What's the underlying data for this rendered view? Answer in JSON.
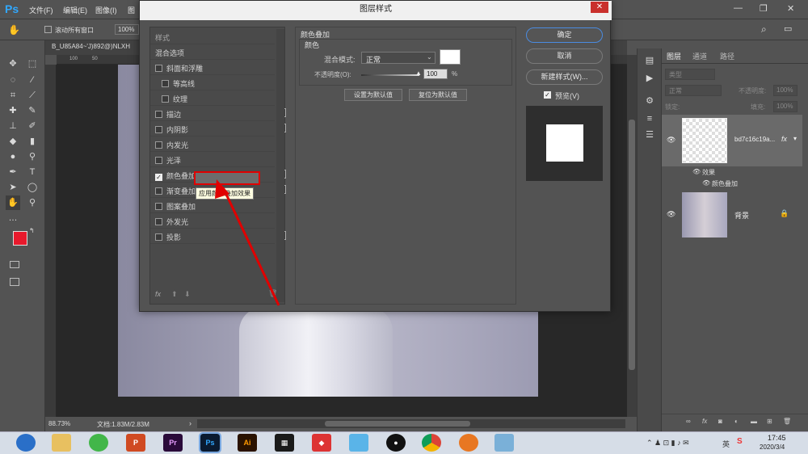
{
  "app": {
    "logo": "Ps"
  },
  "menubar": {
    "items": [
      "文件(F)",
      "编辑(E)",
      "图像(I)",
      "图"
    ]
  },
  "optionsbar": {
    "scroll_all": "滚动所有窗口",
    "zoom": "100%"
  },
  "document": {
    "tab": "B_U85A84~'J)892@)NLXH",
    "zoom_status": "88.73%",
    "doc_info": "文档:1.83M/2.83M",
    "ruler_labels": [
      "100",
      "50"
    ]
  },
  "dialog": {
    "title": "图层样式",
    "close": "✕",
    "list_header": "样式",
    "items": [
      {
        "label": "混合选项",
        "checkbox": false,
        "plus": false,
        "indent": false
      },
      {
        "label": "斜面和浮雕",
        "checkbox": true,
        "checked": false,
        "plus": false,
        "indent": false
      },
      {
        "label": "等高线",
        "checkbox": true,
        "checked": false,
        "plus": false,
        "indent": true
      },
      {
        "label": "纹理",
        "checkbox": true,
        "checked": false,
        "plus": false,
        "indent": true
      },
      {
        "label": "描边",
        "checkbox": true,
        "checked": false,
        "plus": true,
        "indent": false
      },
      {
        "label": "内阴影",
        "checkbox": true,
        "checked": false,
        "plus": true,
        "indent": false
      },
      {
        "label": "内发光",
        "checkbox": true,
        "checked": false,
        "plus": false,
        "indent": false
      },
      {
        "label": "光泽",
        "checkbox": true,
        "checked": false,
        "plus": false,
        "indent": false
      },
      {
        "label": "颜色叠加",
        "checkbox": true,
        "checked": true,
        "plus": true,
        "indent": false
      },
      {
        "label": "渐变叠加",
        "checkbox": true,
        "checked": false,
        "plus": true,
        "indent": false
      },
      {
        "label": "图案叠加",
        "checkbox": true,
        "checked": false,
        "plus": false,
        "indent": false
      },
      {
        "label": "外发光",
        "checkbox": true,
        "checked": false,
        "plus": false,
        "indent": false
      },
      {
        "label": "投影",
        "checkbox": true,
        "checked": false,
        "plus": true,
        "indent": false
      }
    ],
    "tooltip": "应用颜色叠加效果",
    "fx": "fx",
    "settings": {
      "group_title": "颜色叠加",
      "sub_title": "颜色",
      "blend_label": "混合模式:",
      "blend_value": "正常",
      "opacity_label": "不透明度(O):",
      "opacity_value": "100",
      "opacity_unit": "%",
      "set_default": "设置为默认值",
      "reset_default": "复位为默认值"
    },
    "buttons": {
      "ok": "确定",
      "cancel": "取消",
      "new_style": "新建样式(W)...",
      "preview": "预览(V)"
    }
  },
  "layers_panel": {
    "tabs": [
      "图层",
      "通道",
      "路径"
    ],
    "kind_placeholder": "类型",
    "blend": "正常",
    "opacity_label": "不透明度:",
    "opacity_value": "100%",
    "lock_label": "锁定:",
    "fill_label": "填充:",
    "fill_value": "100%",
    "layers": [
      {
        "name": "bd7c16c19a...",
        "fx": "fx",
        "effects_label": "效果",
        "effect": "颜色叠加"
      },
      {
        "name": "背景"
      }
    ]
  },
  "taskbar": {
    "apps": [
      "Pr",
      "Ps",
      "Ai"
    ],
    "time": "17:45",
    "date": "2020/3/4",
    "ime": "英"
  },
  "colors": {
    "foreground": "#e8192c",
    "background": "#ffffff",
    "highlight": "#e00000"
  }
}
